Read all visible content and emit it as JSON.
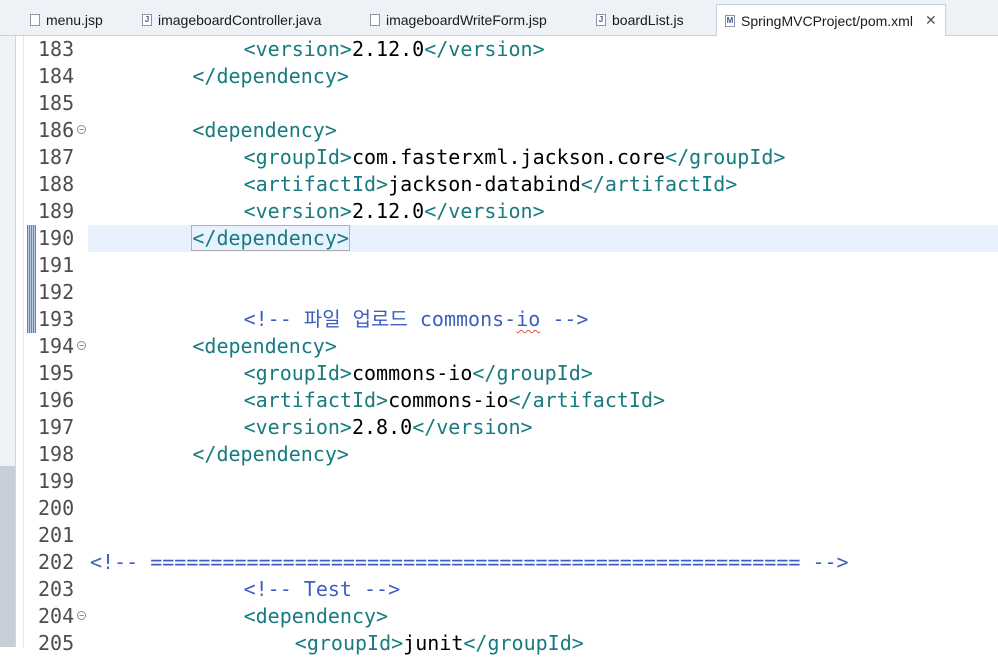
{
  "tabs": [
    {
      "label": "menu.jsp",
      "icon": "jsp-file-icon",
      "active": false
    },
    {
      "label": "imageboardController.java",
      "icon": "java-file-icon",
      "active": false
    },
    {
      "label": "imageboardWriteForm.jsp",
      "icon": "jsp-file-icon",
      "active": false
    },
    {
      "label": "boardList.js",
      "icon": "js-file-icon",
      "active": false
    },
    {
      "label": "SpringMVCProject/pom.xml",
      "icon": "maven-pom-icon",
      "active": true
    }
  ],
  "close_glyph": "✕",
  "lines": [
    {
      "num": "183",
      "code": "<version>2.12.0</version>"
    },
    {
      "num": "184",
      "code": "</dependency>"
    },
    {
      "num": "185",
      "code": ""
    },
    {
      "num": "186",
      "code": "<dependency>"
    },
    {
      "num": "187",
      "code": "<groupId>com.fasterxml.jackson.core</groupId>"
    },
    {
      "num": "188",
      "code": "<artifactId>jackson-databind</artifactId>"
    },
    {
      "num": "189",
      "code": "<version>2.12.0</version>"
    },
    {
      "num": "190",
      "code": "</dependency>"
    },
    {
      "num": "191",
      "code": ""
    },
    {
      "num": "192",
      "code": ""
    },
    {
      "num": "193",
      "code": "<!-- 파일 업로드 commons-io -->"
    },
    {
      "num": "194",
      "code": "<dependency>"
    },
    {
      "num": "195",
      "code": "<groupId>commons-io</groupId>"
    },
    {
      "num": "196",
      "code": "<artifactId>commons-io</artifactId>"
    },
    {
      "num": "197",
      "code": "<version>2.8.0</version>"
    },
    {
      "num": "198",
      "code": "</dependency>"
    },
    {
      "num": "199",
      "code": ""
    },
    {
      "num": "200",
      "code": ""
    },
    {
      "num": "201",
      "code": ""
    },
    {
      "num": "202",
      "code": "<!-- ====================================================== -->"
    },
    {
      "num": "203",
      "code": "<!-- Test -->"
    },
    {
      "num": "204",
      "code": "<dependency>"
    },
    {
      "num": "205",
      "code": "<groupId>junit</groupId>"
    }
  ],
  "colors": {
    "tag": "#177b80",
    "text": "#000000",
    "comment": "#3f5fbf",
    "current_line": "#e8f2fe"
  }
}
